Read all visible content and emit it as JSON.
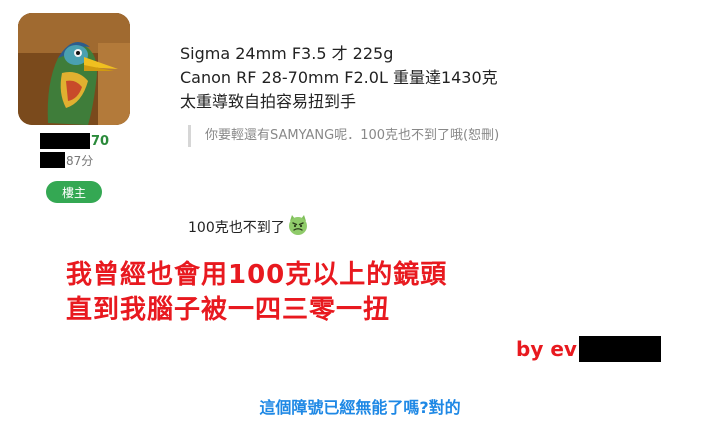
{
  "user": {
    "name_suffix": "70",
    "level_suffix": "87分",
    "badge": "樓主"
  },
  "post": {
    "lines": [
      "Sigma 24mm F3.5 才 225g",
      "Canon RF 28-70mm F2.0L 重量達1430克",
      "太重導致自拍容易扭到手"
    ],
    "quote": "你要輕還有SAMYANG呢．100克也不到了哦(恕刪)"
  },
  "reply": {
    "text": "100克也不到了",
    "emoji": "devil-face-icon"
  },
  "overlay": {
    "line1": "我曾經也會用100克以上的鏡頭",
    "line2": "直到我腦子被一四三零一扭",
    "byline": "by ev"
  },
  "footer": "這個障號已經無能了嗎?對的",
  "colors": {
    "badge": "#34a853",
    "overlay_red": "#e8191f",
    "footer_blue": "#1e88e5",
    "name_green": "#2a8a3a"
  }
}
